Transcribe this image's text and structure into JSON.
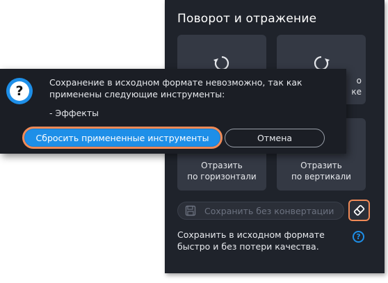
{
  "panel": {
    "title": "Поворот и отражение",
    "tiles": [
      {
        "label_line1": "",
        "label_line2": "",
        "icon": "rotate-left-icon"
      },
      {
        "label_line1": "о",
        "label_line2": "ке",
        "icon": "rotate-right-icon"
      },
      {
        "label_line1": "Отразить",
        "label_line2": "по горизонтали",
        "icon": "flip-horizontal-icon"
      },
      {
        "label_line1": "Отразить",
        "label_line2": "по вертикали",
        "icon": "flip-vertical-icon"
      }
    ],
    "save_button_label": "Сохранить без конвертации",
    "hint_text": "Сохранить в исходном формате быстро и без потери качества.",
    "help_label": "?"
  },
  "dialog": {
    "icon_label": "?",
    "message": "Сохранение в исходном формате невозможно, так как применены следующие инструменты:",
    "tools_list": "- Эффекты",
    "reset_button_label": "Сбросить примененные инструменты",
    "cancel_button_label": "Отмена"
  },
  "colors": {
    "accent": "#1e8fe8",
    "highlight": "#f08a57",
    "panel_bg": "#1f232b",
    "tile_bg": "#343944"
  }
}
